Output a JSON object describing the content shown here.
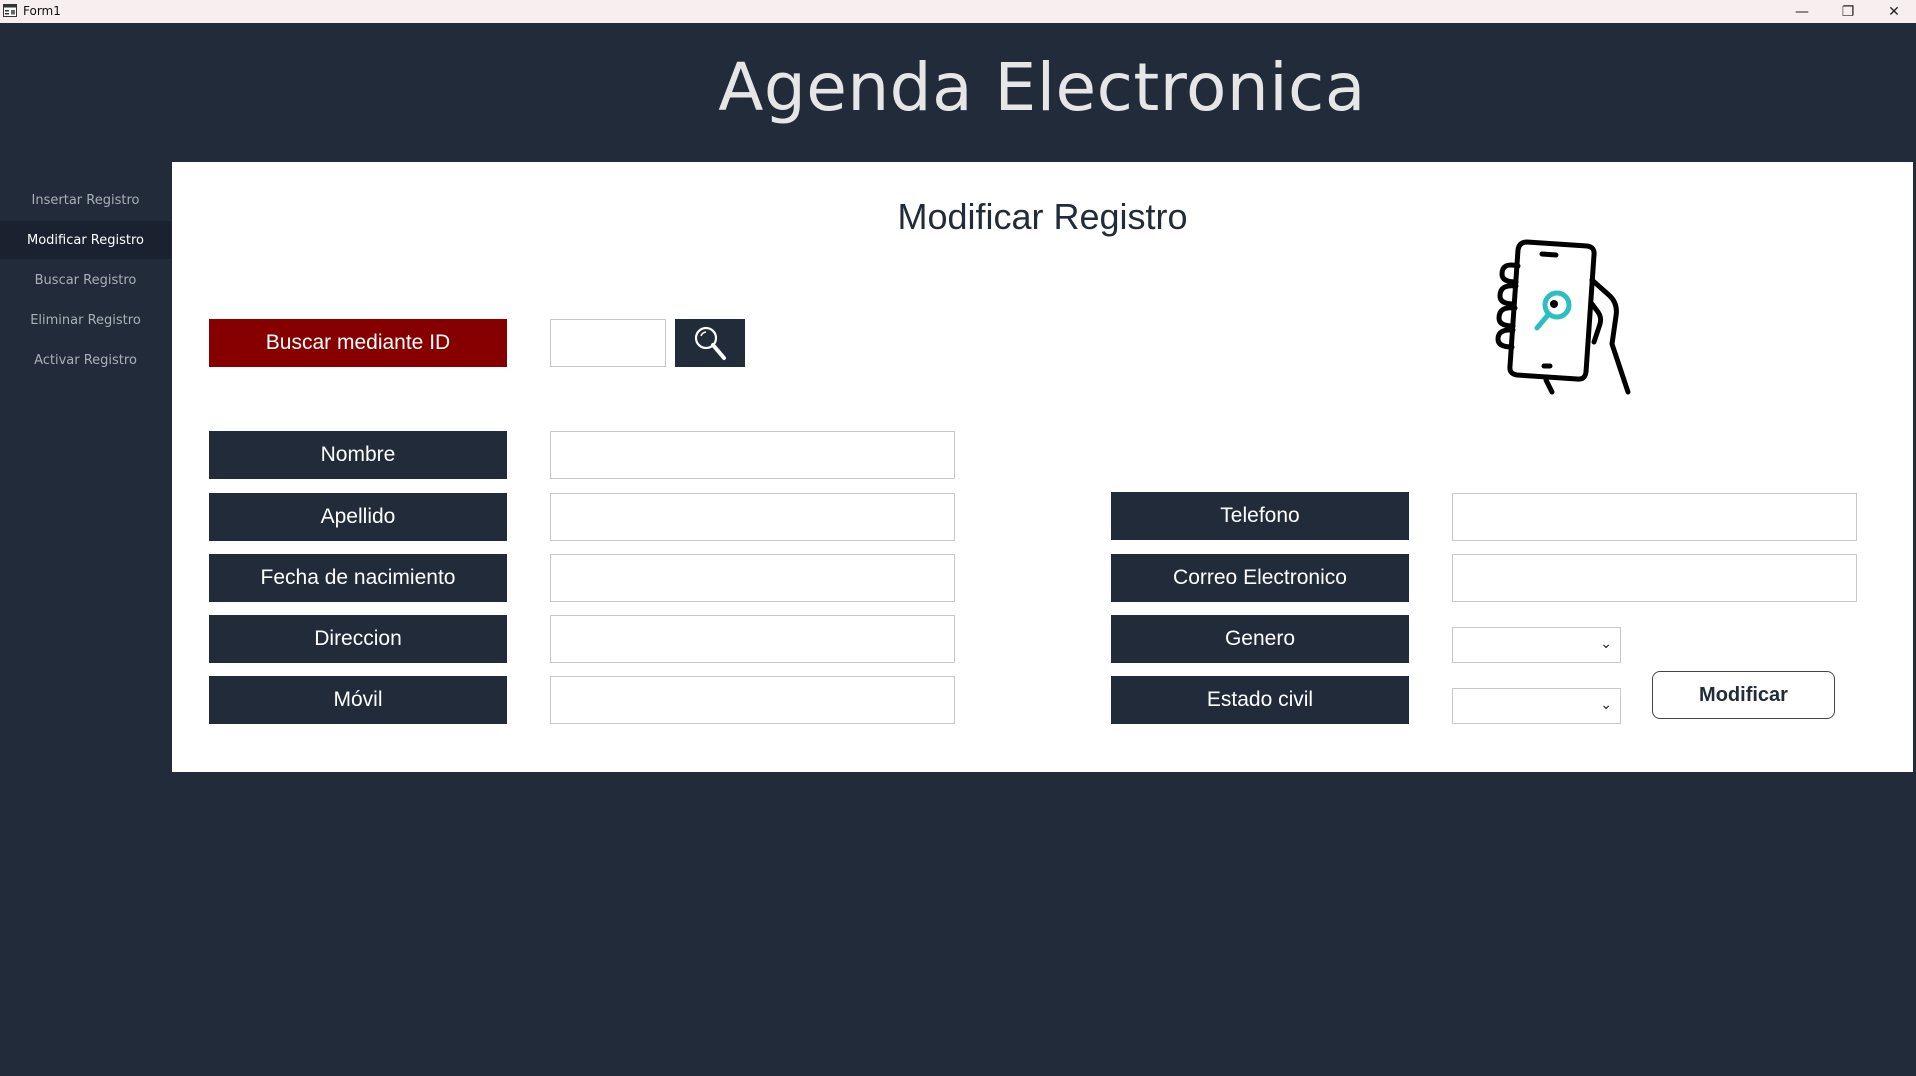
{
  "window": {
    "title": "Form1",
    "controls": {
      "minimize": "—",
      "maximize": "❐",
      "close": "✕"
    }
  },
  "header": {
    "title": "Agenda Electronica"
  },
  "sidebar": {
    "items": [
      {
        "label": "Insertar Registro",
        "active": false
      },
      {
        "label": "Modificar Registro",
        "active": true
      },
      {
        "label": "Buscar Registro",
        "active": false
      },
      {
        "label": "Eliminar Registro",
        "active": false
      },
      {
        "label": "Activar Registro",
        "active": false
      }
    ]
  },
  "main": {
    "title": "Modificar Registro",
    "search": {
      "label": "Buscar mediante ID",
      "id_value": "",
      "button_icon": "search-icon"
    },
    "left_fields": [
      {
        "label": "Nombre",
        "value": ""
      },
      {
        "label": "Apellido",
        "value": ""
      },
      {
        "label": "Fecha de nacimiento",
        "value": ""
      },
      {
        "label": "Direccion",
        "value": ""
      },
      {
        "label": "Móvil",
        "value": ""
      }
    ],
    "right_fields": [
      {
        "label": "Telefono",
        "value": ""
      },
      {
        "label": "Correo Electronico",
        "value": ""
      }
    ],
    "dropdowns": [
      {
        "label": "Genero",
        "selected": ""
      },
      {
        "label": "Estado civil",
        "selected": ""
      }
    ],
    "modify_button": "Modificar",
    "illustration": "phone-search-icon"
  },
  "colors": {
    "navy": "#222b39",
    "red": "#870000",
    "accent": "#2bbfbf",
    "white": "#ffffff"
  }
}
